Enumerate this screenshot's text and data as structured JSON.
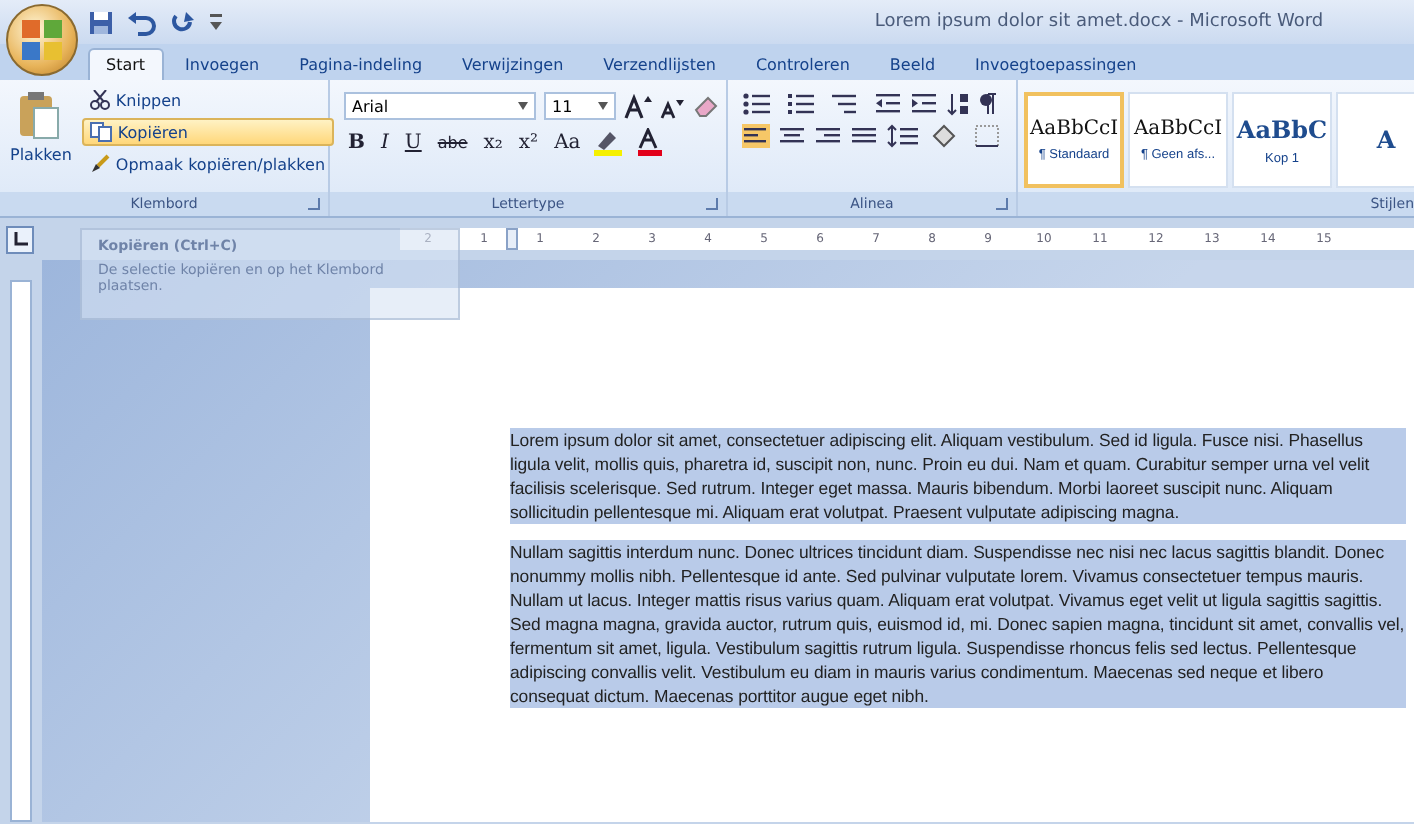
{
  "window": {
    "title": "Lorem ipsum dolor sit amet.docx - Microsoft Word"
  },
  "tabs": [
    {
      "label": "Start",
      "selected": true
    },
    {
      "label": "Invoegen",
      "selected": false
    },
    {
      "label": "Pagina-indeling",
      "selected": false
    },
    {
      "label": "Verwijzingen",
      "selected": false
    },
    {
      "label": "Verzendlijsten",
      "selected": false
    },
    {
      "label": "Controleren",
      "selected": false
    },
    {
      "label": "Beeld",
      "selected": false
    },
    {
      "label": "Invoegtoepassingen",
      "selected": false
    }
  ],
  "clipboard": {
    "label": "Klembord",
    "paste": "Plakken",
    "items": [
      {
        "kind": "cut",
        "label": "Knippen",
        "highlighted": false
      },
      {
        "kind": "copy",
        "label": "Kopiëren",
        "highlighted": true
      },
      {
        "kind": "format",
        "label": "Opmaak kopiëren/plakken",
        "highlighted": false
      }
    ]
  },
  "font": {
    "label": "Lettertype",
    "font_name": "Arial",
    "font_size": "11",
    "format_buttons": [
      {
        "kind": "bold",
        "text": "B"
      },
      {
        "kind": "italic",
        "text": "I"
      },
      {
        "kind": "underline",
        "text": "U"
      },
      {
        "kind": "strike",
        "text": "abe"
      },
      {
        "kind": "plain",
        "text": "x₂"
      },
      {
        "kind": "plain",
        "text": "x²"
      },
      {
        "kind": "plain",
        "text": "Aa"
      }
    ]
  },
  "paragraph": {
    "label": "Alinea"
  },
  "styles": {
    "label": "Stijlen",
    "items": [
      {
        "kind": "body",
        "preview": "AaBbCcI",
        "name": "¶ Standaard",
        "selected": true
      },
      {
        "kind": "body",
        "preview": "AaBbCcI",
        "name": "¶ Geen afs...",
        "selected": false
      },
      {
        "kind": "heading",
        "preview": "AaBbC",
        "name": "Kop 1",
        "selected": false
      },
      {
        "kind": "heading",
        "preview": "A",
        "selected": false
      }
    ]
  },
  "tooltip": {
    "title": "Kopiëren (Ctrl+C)",
    "description": "De selectie kopiëren en op het Klembord plaatsen."
  },
  "ruler": {
    "left_labels": [
      "2",
      "1"
    ],
    "right_labels": [
      "1",
      "2",
      "3",
      "4",
      "5",
      "6",
      "7",
      "8",
      "9",
      "10",
      "11",
      "12",
      "13",
      "14",
      "15"
    ]
  },
  "document": {
    "paragraphs": [
      {
        "text": "Lorem ipsum dolor sit amet, consectetuer adipiscing elit. Aliquam vestibulum. Sed id ligula. Fusce nisi. Phasellus ligula velit, mollis quis, pharetra id, suscipit non, nunc. Proin eu dui. Nam et quam. Curabitur semper urna vel velit facilisis scelerisque. Sed rutrum. Integer eget massa. Mauris bibendum. Morbi laoreet suscipit nunc. Aliquam sollicitudin pellentesque mi. Aliquam erat volutpat. Praesent vulputate adipiscing magna.",
        "selected": true
      },
      {
        "text": "Nullam sagittis interdum nunc. Donec ultrices tincidunt diam. Suspendisse nec nisi nec lacus sagittis blandit. Donec nonummy mollis nibh. Pellentesque id ante. Sed pulvinar vulputate lorem. Vivamus consectetuer tempus mauris. Nullam ut lacus. Integer mattis risus varius quam. Aliquam erat volutpat. Vivamus eget velit ut ligula sagittis sagittis. Sed magna magna, gravida auctor, rutrum quis, euismod id, mi. Donec sapien magna, tincidunt sit amet, convallis vel, fermentum sit amet, ligula. Vestibulum sagittis rutrum ligula. Suspendisse rhoncus felis sed lectus. Pellentesque adipiscing convallis velit. Vestibulum eu diam in mauris varius condimentum. Maecenas sed neque et libero consequat dictum. Maecenas porttitor augue eget nibh.",
        "selected": true
      }
    ]
  }
}
